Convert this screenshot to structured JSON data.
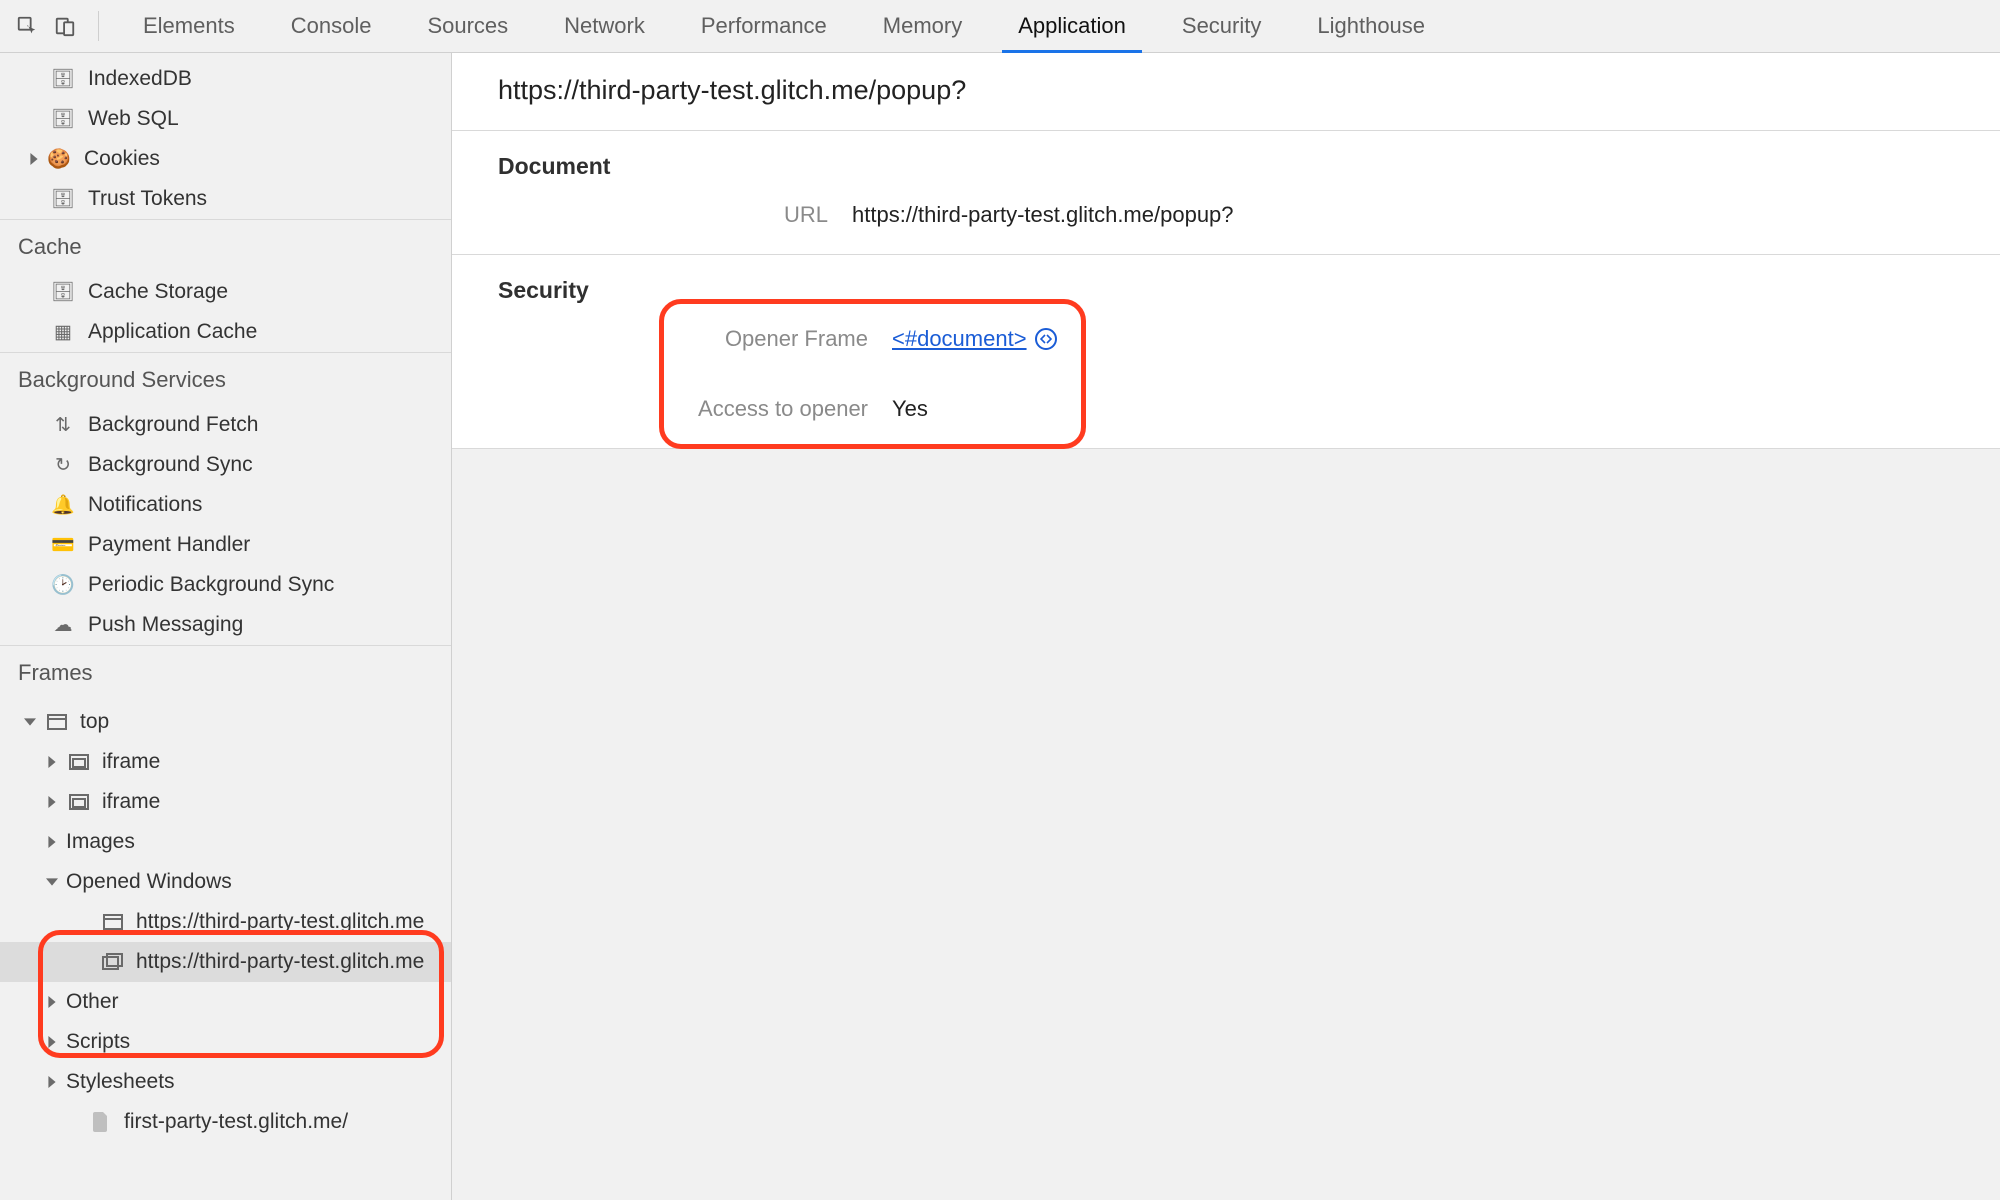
{
  "tabs": {
    "items": [
      "Elements",
      "Console",
      "Sources",
      "Network",
      "Performance",
      "Memory",
      "Application",
      "Security",
      "Lighthouse"
    ],
    "active": "Application"
  },
  "sidebar": {
    "storage": {
      "items": [
        {
          "icon": "db",
          "label": "IndexedDB"
        },
        {
          "icon": "db",
          "label": "Web SQL"
        },
        {
          "icon": "cookie",
          "label": "Cookies",
          "expandable": true
        },
        {
          "icon": "db",
          "label": "Trust Tokens"
        }
      ]
    },
    "cache": {
      "title": "Cache",
      "items": [
        {
          "icon": "db",
          "label": "Cache Storage"
        },
        {
          "icon": "grid",
          "label": "Application Cache"
        }
      ]
    },
    "bg": {
      "title": "Background Services",
      "items": [
        {
          "icon": "transfer",
          "label": "Background Fetch"
        },
        {
          "icon": "sync",
          "label": "Background Sync"
        },
        {
          "icon": "bell",
          "label": "Notifications"
        },
        {
          "icon": "card",
          "label": "Payment Handler"
        },
        {
          "icon": "clock",
          "label": "Periodic Background Sync"
        },
        {
          "icon": "cloud",
          "label": "Push Messaging"
        }
      ]
    },
    "frames": {
      "title": "Frames",
      "top": "top",
      "iframe": "iframe",
      "images": "Images",
      "opened_windows": "Opened Windows",
      "ow1": "https://third-party-test.glitch.me",
      "ow2": "https://third-party-test.glitch.me",
      "other": "Other",
      "scripts": "Scripts",
      "stylesheets": "Stylesheets",
      "leaf": "first-party-test.glitch.me/"
    }
  },
  "main": {
    "title": "https://third-party-test.glitch.me/popup?",
    "document": {
      "heading": "Document",
      "url_label": "URL",
      "url_value": "https://third-party-test.glitch.me/popup?"
    },
    "security": {
      "heading": "Security",
      "opener_label": "Opener Frame",
      "opener_value": "<#document>",
      "access_label": "Access to opener",
      "access_value": "Yes"
    }
  }
}
